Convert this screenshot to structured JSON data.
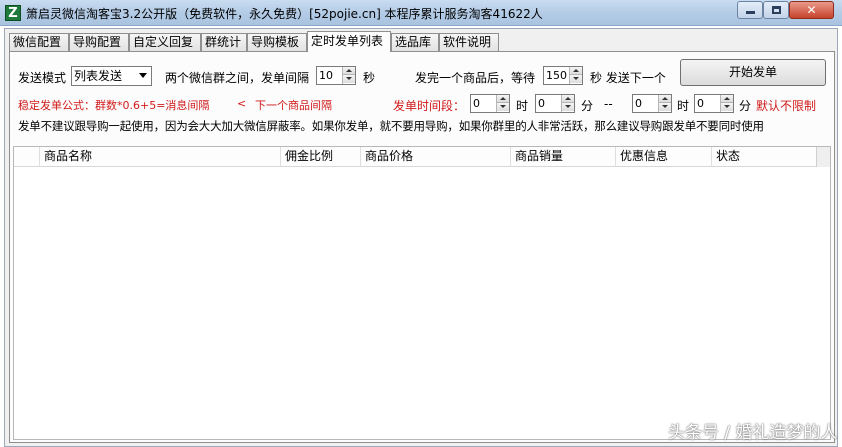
{
  "window": {
    "title": "箫启灵微信淘客宝3.2公开版（免费软件，永久免费）[52pojie.cn]  本程序累计服务淘客41622人",
    "app_icon": "Z"
  },
  "tabs": [
    "微信配置",
    "导购配置",
    "自定义回复",
    "群统计",
    "导购模板",
    "定时发单列表",
    "选品库",
    "软件说明"
  ],
  "active_tab": "定时发单列表",
  "settings": {
    "send_mode_label": "发送模式",
    "send_mode_value": "列表发送",
    "group_interval_label": "两个微信群之间，发单间隔",
    "group_interval_value": "10",
    "seconds_label": "秒",
    "after_product_label": "发完一个商品后，等待",
    "after_product_value": "150",
    "next_label": "秒 发送下一个",
    "start_button": "开始发单",
    "formula_label": "稳定发单公式：群数*0.6+5=消息间隔",
    "formula_arrow": "<",
    "formula_tail": "下一个商品间隔",
    "time_range_label": "发单时间段：",
    "start_hour": "0",
    "hour_label": "时",
    "start_minute": "0",
    "minute_label": "分",
    "dash": "--",
    "end_hour": "0",
    "hour_label2": "时",
    "end_minute": "0",
    "minute_label2": "分",
    "default_note": "默认不限制",
    "advice": "发单不建议跟导购一起使用，因为会大大加大微信屏蔽率。如果你发单，就不要用导购，如果你群里的人非常活跃，那么建议导购跟发单不要同时使用"
  },
  "table": {
    "columns": [
      "商品名称",
      "佣金比例",
      "商品价格",
      "商品销量",
      "优惠信息",
      "状态"
    ]
  },
  "watermark": "头条号 / 婚礼造梦的人"
}
